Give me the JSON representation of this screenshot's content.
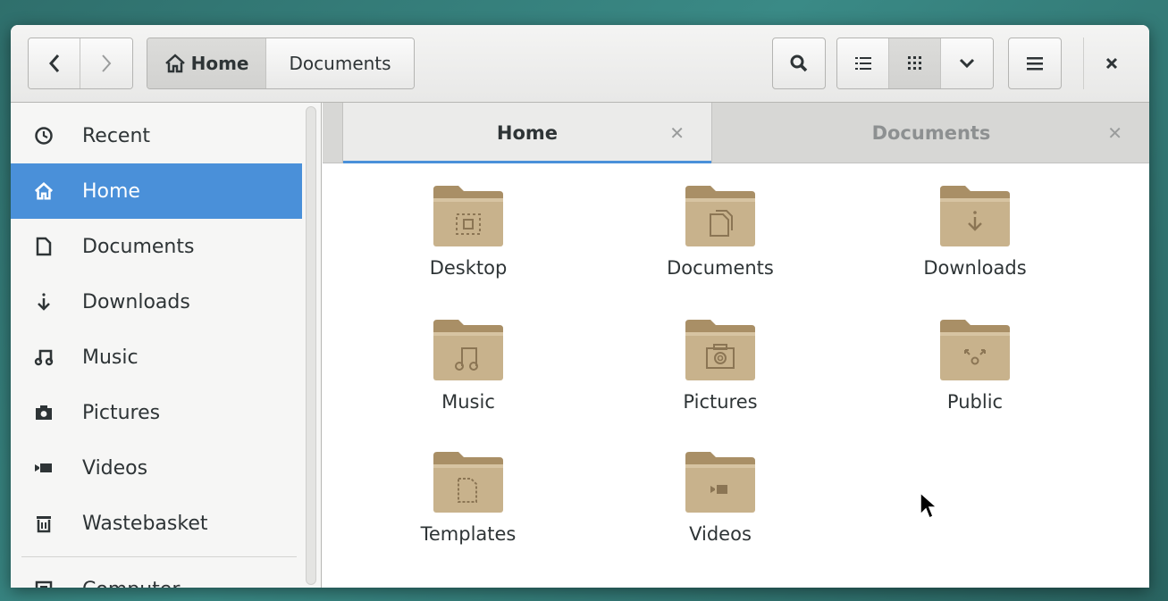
{
  "header": {
    "back_icon": "chevron-left-icon",
    "forward_icon": "chevron-right-icon",
    "path": [
      {
        "label": "Home",
        "icon": "home-icon"
      },
      {
        "label": "Documents"
      }
    ],
    "search_icon": "search-icon",
    "view_list_icon": "list-view-icon",
    "view_grid_icon": "grid-view-icon",
    "view_dropdown_icon": "chevron-down-icon",
    "menu_icon": "hamburger-menu-icon",
    "close_icon": "close-icon"
  },
  "sidebar": {
    "items": [
      {
        "label": "Recent",
        "icon": "clock-icon"
      },
      {
        "label": "Home",
        "icon": "home-icon",
        "selected": true
      },
      {
        "label": "Documents",
        "icon": "document-icon"
      },
      {
        "label": "Downloads",
        "icon": "download-icon"
      },
      {
        "label": "Music",
        "icon": "music-icon"
      },
      {
        "label": "Pictures",
        "icon": "camera-icon"
      },
      {
        "label": "Videos",
        "icon": "video-icon"
      },
      {
        "label": "Wastebasket",
        "icon": "trash-icon"
      },
      {
        "label": "Computer",
        "icon": "computer-icon"
      }
    ]
  },
  "tabs": [
    {
      "label": "Home",
      "active": true
    },
    {
      "label": "Documents",
      "active": false
    }
  ],
  "files": [
    {
      "name": "Desktop",
      "emblem": "desktop"
    },
    {
      "name": "Documents",
      "emblem": "documents"
    },
    {
      "name": "Downloads",
      "emblem": "downloads"
    },
    {
      "name": "Music",
      "emblem": "music"
    },
    {
      "name": "Pictures",
      "emblem": "pictures"
    },
    {
      "name": "Public",
      "emblem": "public"
    },
    {
      "name": "Templates",
      "emblem": "templates"
    },
    {
      "name": "Videos",
      "emblem": "videos"
    }
  ],
  "colors": {
    "accent": "#4a90d9",
    "folder": "#c8b28c",
    "folder_dark": "#a98f66"
  }
}
